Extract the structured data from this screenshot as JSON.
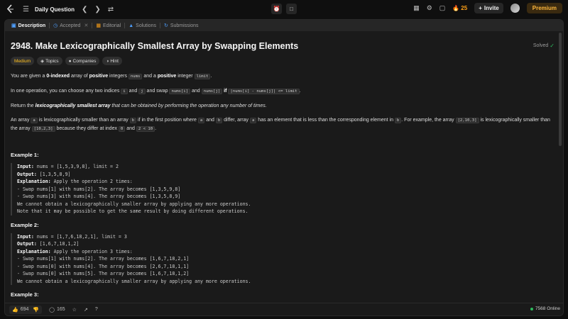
{
  "topbar": {
    "title": "Daily Question",
    "streak": "25",
    "invite": "Invite",
    "premium": "Premium"
  },
  "tabs": [
    {
      "label": "Description",
      "icon": "doc-icon"
    },
    {
      "label": "Accepted",
      "icon": "clock-icon"
    },
    {
      "label": "Editorial",
      "icon": "book-icon"
    },
    {
      "label": "Solutions",
      "icon": "flask-icon"
    },
    {
      "label": "Submissions",
      "icon": "history-icon"
    }
  ],
  "problem": {
    "title": "2948. Make Lexicographically Smallest Array by Swapping Elements",
    "status": "Solved",
    "tags": [
      "Medium",
      "Topics",
      "Companies",
      "Hint"
    ]
  },
  "desc": {
    "p1a": "You are given a ",
    "p1b": "0-indexed",
    "p1c": " array of ",
    "p1d": "positive",
    "p1e": " integers ",
    "p1f": "nums",
    "p1g": " and a ",
    "p1h": "positive",
    "p1i": " integer ",
    "p1j": "limit",
    "p1k": ".",
    "p2a": "In one operation, you can choose any two indices ",
    "p2b": "i",
    "p2c": " and ",
    "p2d": "j",
    "p2e": " and swap ",
    "p2f": "nums[i]",
    "p2g": " and ",
    "p2h": "nums[j]",
    "p2i": " if ",
    "p2j": "|nums[i] - nums[j]| <= limit",
    "p2k": ".",
    "p3a": "Return the ",
    "p3b": "lexicographically smallest array",
    "p3c": " that can be obtained by performing the operation any number of times.",
    "p4a": "An array ",
    "p4b": "a",
    "p4c": " is lexicographically smaller than an array ",
    "p4d": "b",
    "p4e": " if in the first position where ",
    "p4f": "a",
    "p4g": " and ",
    "p4h": "b",
    "p4i": " differ, array ",
    "p4j": "a",
    "p4k": " has an element that is less than the corresponding element in ",
    "p4l": "b",
    "p4m": ". For example, the array ",
    "p4n": "[2,10,3]",
    "p4o": " is lexicographically smaller than the array ",
    "p4p": "[10,2,3]",
    "p4q": " because they differ at index ",
    "p4r": "0",
    "p4s": " and ",
    "p4t": "2 < 10",
    "p4u": "."
  },
  "examples": [
    {
      "title": "Example 1:",
      "input_label": "Input:",
      "input": " nums = [1,5,3,9,8], limit = 2",
      "output_label": "Output:",
      "output": " [1,3,5,8,9]",
      "expl_label": "Explanation:",
      "expl": " Apply the operation 2 times:\n- Swap nums[1] with nums[2]. The array becomes [1,3,5,9,8]\n- Swap nums[3] with nums[4]. The array becomes [1,3,5,8,9]\nWe cannot obtain a lexicographically smaller array by applying any more operations.\nNote that it may be possible to get the same result by doing different operations."
    },
    {
      "title": "Example 2:",
      "input_label": "Input:",
      "input": " nums = [1,7,6,18,2,1], limit = 3",
      "output_label": "Output:",
      "output": " [1,6,7,18,1,2]",
      "expl_label": "Explanation:",
      "expl": " Apply the operation 3 times:\n- Swap nums[1] with nums[2]. The array becomes [1,6,7,18,2,1]\n- Swap nums[0] with nums[4]. The array becomes [2,6,7,18,1,1]\n- Swap nums[0] with nums[5]. The array becomes [1,6,7,18,1,2]\nWe cannot obtain a lexicographically smaller array by applying any more operations."
    }
  ],
  "example3_title": "Example 3:",
  "bottom": {
    "likes": "694",
    "comments": "165",
    "online": "7568 Online"
  }
}
